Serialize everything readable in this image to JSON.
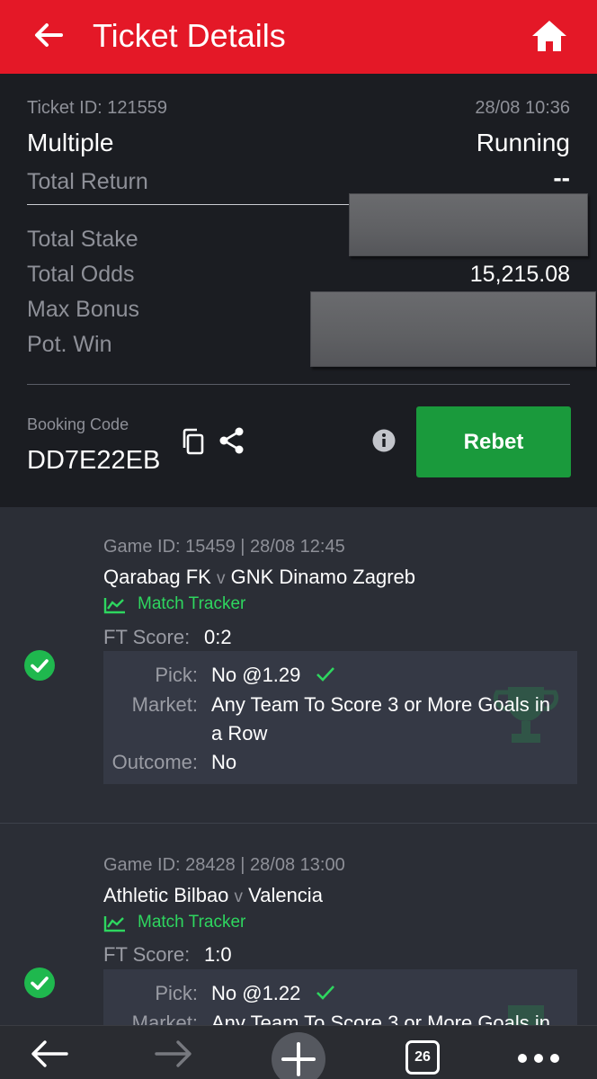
{
  "header": {
    "title": "Ticket Details"
  },
  "ticket": {
    "id_label": "Ticket ID: 121559",
    "datetime": "28/08 10:36",
    "type": "Multiple",
    "status": "Running",
    "total_return_label": "Total Return",
    "total_return_value": "--",
    "total_stake_label": "Total Stake",
    "total_odds_label": "Total Odds",
    "total_odds_value": "15,215.08",
    "max_bonus_label": "Max Bonus",
    "pot_win_label": "Pot. Win",
    "booking_code_label": "Booking Code",
    "booking_code": "DD7E22EB",
    "rebet_label": "Rebet"
  },
  "selections": [
    {
      "game_line": "Game ID: 15459 | 28/08 12:45",
      "home": "Qarabag FK",
      "vs": "v",
      "away": "GNK Dinamo Zagreb",
      "tracker": "Match Tracker",
      "ft_label": "FT Score:",
      "ft_value": "0:2",
      "pick_label": "Pick:",
      "pick_value": "No @1.29",
      "market_label": "Market:",
      "market_line1": "Any Team To Score 3 or More Goals in",
      "market_line2": "a Row",
      "outcome_label": "Outcome:",
      "outcome_value": "No"
    },
    {
      "game_line": "Game ID: 28428 | 28/08 13:00",
      "home": "Athletic Bilbao",
      "vs": "v",
      "away": "Valencia",
      "tracker": "Match Tracker",
      "ft_label": "FT Score:",
      "ft_value": "1:0",
      "pick_label": "Pick:",
      "pick_value": "No @1.22",
      "market_label": "Market:",
      "market_line1": "Any Team To Score 3 or More Goals in"
    }
  ],
  "bottom_nav": {
    "tab_count": "26"
  },
  "colors": {
    "accent_red": "#e41827",
    "success_green": "#1fb84e",
    "button_green": "#1a9a3c"
  }
}
